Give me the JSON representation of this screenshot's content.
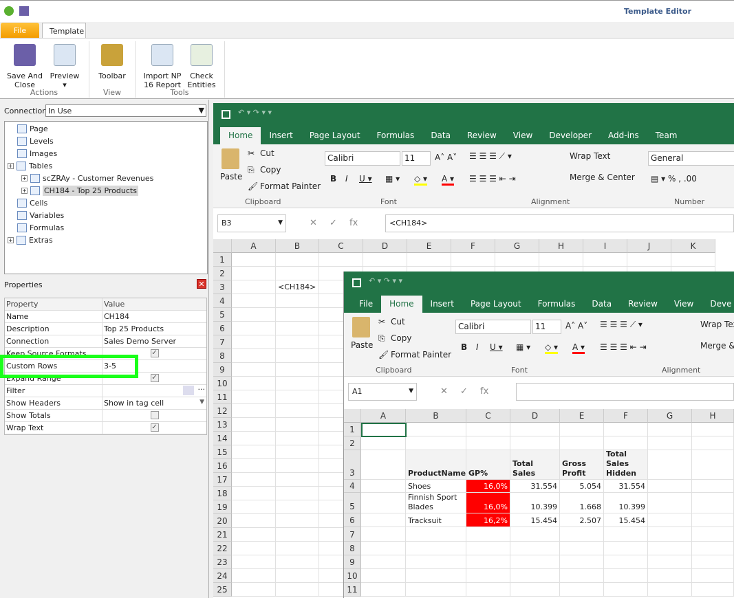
{
  "app": {
    "title": "Template Editor",
    "tabs": [
      "File",
      "Template"
    ]
  },
  "ribbon": {
    "buttons": [
      {
        "label": "Save And Close",
        "icon": "save-close-icon"
      },
      {
        "label": "Preview",
        "icon": "preview-icon"
      },
      {
        "label": "Toolbar",
        "icon": "toolbar-icon"
      },
      {
        "label": "Import NP 16 Report",
        "icon": "import-icon"
      },
      {
        "label": "Check Entities",
        "icon": "check-entities-icon"
      }
    ],
    "groups": [
      "Actions",
      "View",
      "Tools"
    ]
  },
  "connection": {
    "label": "Connection",
    "value": "In Use"
  },
  "tree": [
    {
      "label": "Page"
    },
    {
      "label": "Levels"
    },
    {
      "label": "Images"
    },
    {
      "label": "Tables"
    },
    {
      "label": "scZRAy - Customer Revenues"
    },
    {
      "label": "CH184 - Top 25 Products"
    },
    {
      "label": "Cells"
    },
    {
      "label": "Variables"
    },
    {
      "label": "Formulas"
    },
    {
      "label": "Extras"
    }
  ],
  "properties": {
    "title": "Properties",
    "headers": [
      "Property",
      "Value"
    ],
    "rows": [
      {
        "k": "Name",
        "v": "CH184"
      },
      {
        "k": "Description",
        "v": "Top 25 Products"
      },
      {
        "k": "Connection",
        "v": "Sales Demo Server"
      },
      {
        "k": "Keep Source Formats",
        "check": true
      },
      {
        "k": "Custom Rows",
        "v": "3-5"
      },
      {
        "k": "Expand Range",
        "check": true
      },
      {
        "k": "Filter",
        "v": ""
      },
      {
        "k": "Show Headers",
        "v": "Show in tag cell"
      },
      {
        "k": "Show Totals",
        "check": false
      },
      {
        "k": "Wrap Text",
        "check": true
      }
    ]
  },
  "excel_back": {
    "tabs": [
      "Home",
      "Insert",
      "Page Layout",
      "Formulas",
      "Data",
      "Review",
      "View",
      "Developer",
      "Add-ins",
      "Team"
    ],
    "clipboard": {
      "paste": "Paste",
      "cut": "Cut",
      "copy": "Copy",
      "format_painter": "Format Painter",
      "group": "Clipboard"
    },
    "font": {
      "name": "Calibri",
      "size": "11",
      "group": "Font"
    },
    "alignment": {
      "wrap": "Wrap Text",
      "merge": "Merge & Center",
      "group": "Alignment"
    },
    "number": {
      "format": "General",
      "group": "Number"
    },
    "name_box": "B3",
    "formula": "<CH184>",
    "columns": [
      "A",
      "B",
      "C",
      "D",
      "E",
      "F",
      "G",
      "H",
      "I",
      "J",
      "K"
    ],
    "rows": [
      "1",
      "2",
      "3",
      "4",
      "5",
      "6",
      "7",
      "8",
      "9",
      "10",
      "11",
      "12",
      "13",
      "14",
      "15",
      "16",
      "17",
      "18",
      "19",
      "20",
      "21",
      "22",
      "23",
      "24",
      "25"
    ],
    "cell_b3": "<CH184>"
  },
  "excel_front": {
    "tabs": [
      "File",
      "Home",
      "Insert",
      "Page Layout",
      "Formulas",
      "Data",
      "Review",
      "View",
      "Deve"
    ],
    "clipboard": {
      "paste": "Paste",
      "cut": "Cut",
      "copy": "Copy",
      "format_painter": "Format Painter",
      "group": "Clipboard"
    },
    "font": {
      "name": "Calibri",
      "size": "11",
      "group": "Font"
    },
    "alignment": {
      "wrap": "Wrap Tex",
      "merge": "Merge & ",
      "group": "Alignment"
    },
    "name_box": "A1",
    "columns": [
      "A",
      "B",
      "C",
      "D",
      "E",
      "F",
      "G",
      "H"
    ],
    "rows": [
      "1",
      "2",
      "3",
      "4",
      "5",
      "6",
      "7",
      "8",
      "9",
      "10",
      "11"
    ],
    "table": {
      "headers": [
        "ProductName",
        "GP%",
        "Total Sales",
        "Gross Profit",
        "Total Sales Hidden"
      ],
      "data": [
        [
          "Conserve Shoes",
          "16,0%",
          "31.554",
          "5.054",
          "31.554"
        ],
        [
          "Finnish Sport Blades",
          "16,0%",
          "10.399",
          "1.668",
          "10.399"
        ],
        [
          "Tracksuit",
          "16,2%",
          "15.454",
          "2.507",
          "15.454"
        ]
      ]
    },
    "highlight_color": "#ff0000"
  },
  "colors": {
    "excel_green": "#217346",
    "highlight": "#1aff1a"
  }
}
